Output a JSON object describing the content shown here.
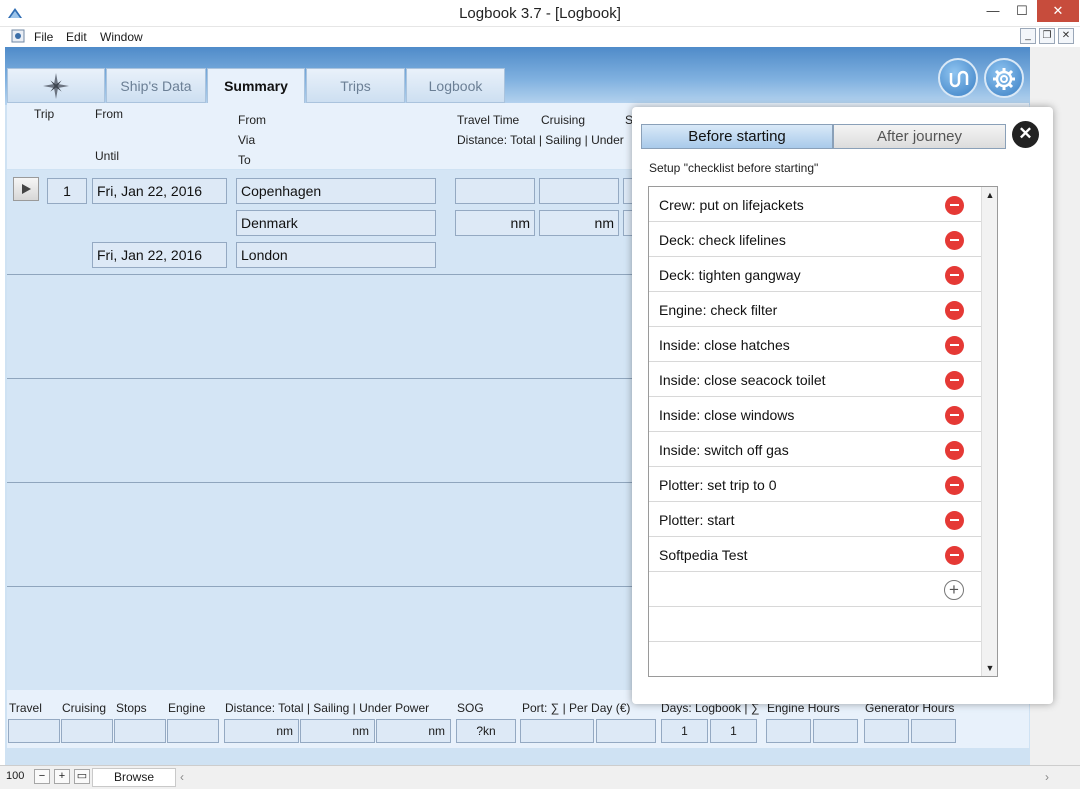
{
  "window": {
    "title": "Logbook 3.7 - [Logbook]",
    "min": "—",
    "max": "☐",
    "close": "✕"
  },
  "menu": [
    "File",
    "Edit",
    "Window"
  ],
  "mdi": {
    "min": "_",
    "restore": "❐",
    "close": "✕"
  },
  "tabs": [
    "Ship's Data",
    "Summary",
    "Trips",
    "Logbook"
  ],
  "active_tab": "Summary",
  "header": {
    "trip": "Trip",
    "from": "From",
    "until": "Until",
    "from2": "From",
    "via": "Via",
    "to": "To",
    "travel_time": "Travel Time",
    "cruising": "Cruising",
    "s": "S",
    "distance": "Distance: Total | Sailing | Under"
  },
  "row": {
    "trip_no": "1",
    "from_date": "Fri, Jan 22, 2016",
    "until_date": "Fri, Jan 22, 2016",
    "from_place": "Copenhagen",
    "via_place": "Denmark",
    "to_place": "London",
    "unit1": "nm",
    "unit2": "nm"
  },
  "footer": {
    "labels": {
      "travel": "Travel",
      "cruising": "Cruising",
      "stops": "Stops",
      "engine": "Engine",
      "distance": "Distance: Total | Sailing | Under Power",
      "sog": "SOG",
      "port": "Port: ∑ | Per Day (€)",
      "days": "Days: Logbook | ∑",
      "engine_hours": "Engine Hours",
      "generator_hours": "Generator Hours"
    },
    "values": {
      "nm1": "nm",
      "nm2": "nm",
      "nm3": "nm",
      "sog": "?kn",
      "days1": "1",
      "days2": "1"
    }
  },
  "status": {
    "zoom": "100",
    "mode": "Browse"
  },
  "popup": {
    "seg_before": "Before starting",
    "seg_after": "After journey",
    "setup_label": "Setup \"checklist before starting\"",
    "items": [
      "Crew: put on lifejackets",
      "Deck: check lifelines",
      "Deck: tighten gangway",
      "Engine: check filter",
      "Inside: close hatches",
      "Inside: close seacock toilet",
      "Inside: close windows",
      "Inside: switch off gas",
      "Plotter: set trip to 0",
      "Plotter: start",
      "Softpedia Test"
    ]
  }
}
